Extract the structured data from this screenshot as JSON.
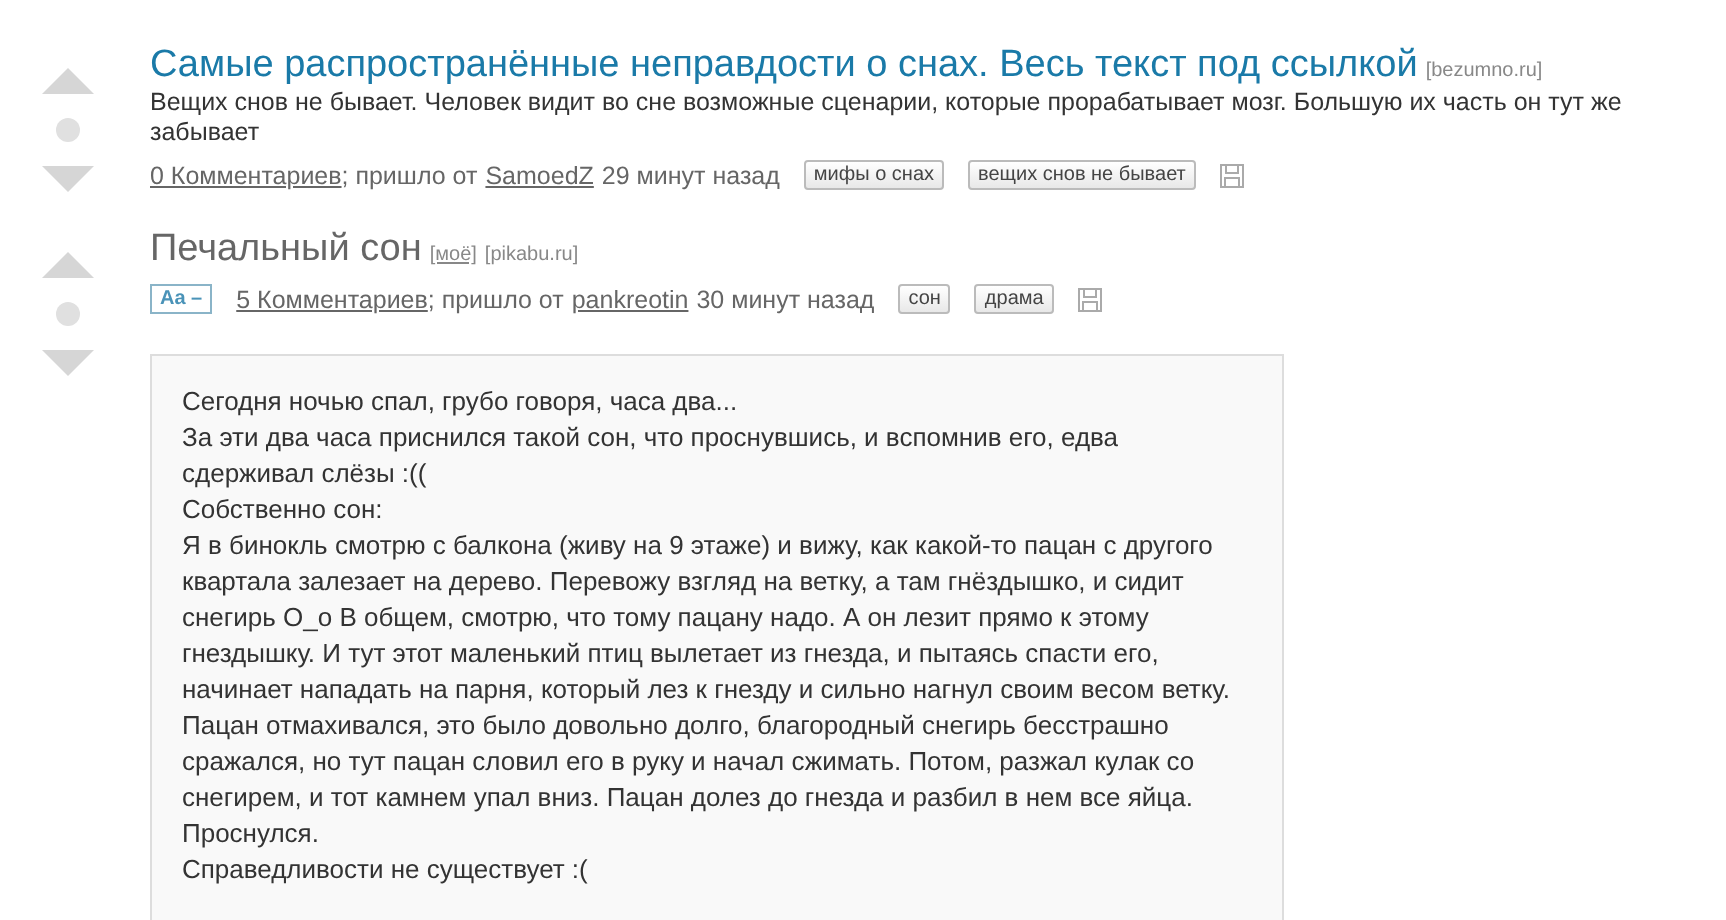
{
  "posts": [
    {
      "kind": "link",
      "title": "Самые распространённые неправдости о снах. Весь текст под ссылкой",
      "source": "[bezumno.ru]",
      "description": "Вещих снов не бывает. Человек видит во сне возможные сценарии, которые прорабатывает мозг. Большую их часть он тут же забывает",
      "comments": "0 Комментариев",
      "posted_by": "; пришло от",
      "author": "SamoedZ",
      "time": "29 минут назад",
      "tags": [
        "мифы о снах",
        "вещих снов не бывает"
      ]
    },
    {
      "kind": "text",
      "title": "Печальный сон",
      "labels": [
        "[моё]"
      ],
      "source": "[pikabu.ru]",
      "text_size_button": "Aa –",
      "comments": "5 Комментариев",
      "posted_by": "; пришло от",
      "author": "pankreotin",
      "time": "30 минут назад",
      "tags": [
        "сон",
        "драма"
      ],
      "body": [
        "Сегодня ночью спал, грубо говоря, часа два...",
        "За эти два часа приснился такой сон, что проснувшись, и вспомнив его, едва сдерживал слёзы :((",
        "Собственно сон:",
        "Я в бинокль смотрю с балкона (живу на 9 этаже) и вижу, как какой-то пацан с другого квартала залезает на дерево. Перевожу взгляд на ветку, а там гнёздышко, и сидит снегирь О_о В общем, смотрю, что тому пацану надо. А он лезит прямо к этому гнездышку. И тут этот маленький птиц вылетает из гнезда, и пытаясь спасти его, начинает нападать на парня, который лез к гнезду и сильно нагнул своим весом ветку. Пацан отмахивался, это было довольно долго, благородный снегирь бесстрашно сражался, но тут пацан словил его в руку и начал сжимать. Потом, разжал кулак со снегирем, и тот камнем упал вниз. Пацан долез до гнезда и разбил в нем все яйца.",
        "Проснулся.",
        "Справедливости не существует :("
      ]
    }
  ]
}
